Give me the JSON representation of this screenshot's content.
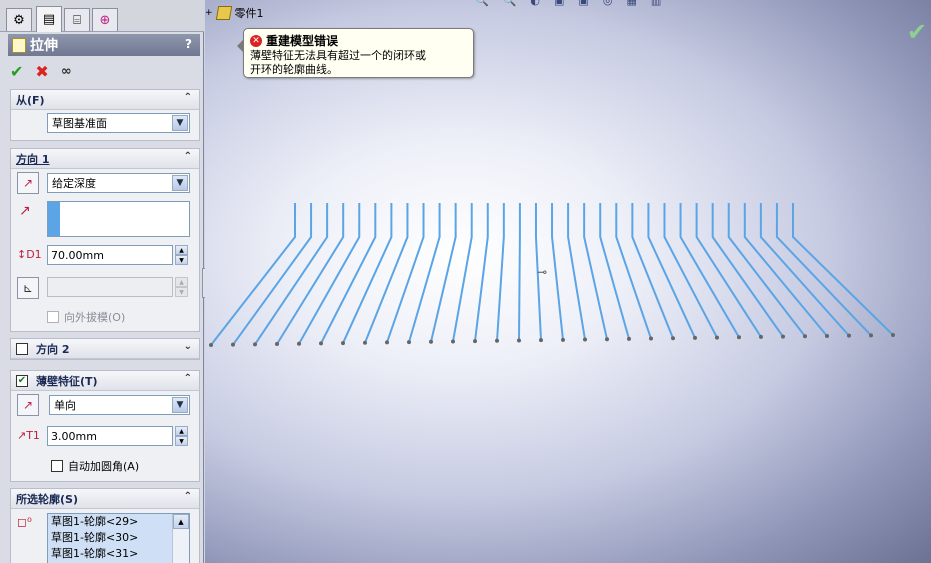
{
  "feature_tree": {
    "root_label": "零件1"
  },
  "property_manager": {
    "title": "拉伸",
    "help": "?",
    "actions": {
      "ok_icon": "check-icon",
      "cancel_icon": "x-icon",
      "preview_icon": "glasses-icon"
    },
    "from": {
      "heading": "从(F)",
      "value": "草图基准面"
    },
    "direction1": {
      "heading": "方向 1",
      "end_condition": "给定深度",
      "depth": "70.00mm",
      "draft_outward": "向外拔模(O)"
    },
    "direction2": {
      "heading": "方向 2"
    },
    "thin_feature": {
      "heading": "薄壁特征(T)",
      "type": "单向",
      "thickness": "3.00mm",
      "auto_fillet": "自动加圆角(A)"
    },
    "selected_contours": {
      "heading": "所选轮廓(S)",
      "items": [
        "草图1-轮廓<29>",
        "草图1-轮廓<30>",
        "草图1-轮廓<31>"
      ]
    }
  },
  "error_tooltip": {
    "title": "重建模型错误",
    "line1": "薄壁特征无法具有超过一个的闭环或",
    "line2": "开环的轮廓曲线。"
  },
  "colors": {
    "accent_blue": "#5ba4e6",
    "error_red": "#dd2222",
    "ok_green": "#22a022"
  }
}
